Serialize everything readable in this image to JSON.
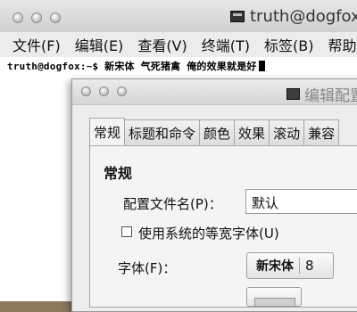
{
  "terminal": {
    "title": "truth@dogfox:",
    "menus": [
      "文件(F)",
      "编辑(E)",
      "查看(V)",
      "终端(T)",
      "标签(B)",
      "帮助"
    ],
    "prompt_text": "truth@dogfox:~$ 新宋体 气死猪禽 俺的效果就是好"
  },
  "dialog": {
    "title": "编辑配置",
    "tabs": [
      "常规",
      "标题和命令",
      "颜色",
      "效果",
      "滚动",
      "兼容"
    ],
    "section_title": "常规",
    "profile_name_label": "配置文件名(P)：",
    "profile_name_value": "默认",
    "system_font_label": "使用系统的等宽字体(U)",
    "font_label": "字体(F)：",
    "font_name": "新宋体",
    "font_size": "8"
  }
}
